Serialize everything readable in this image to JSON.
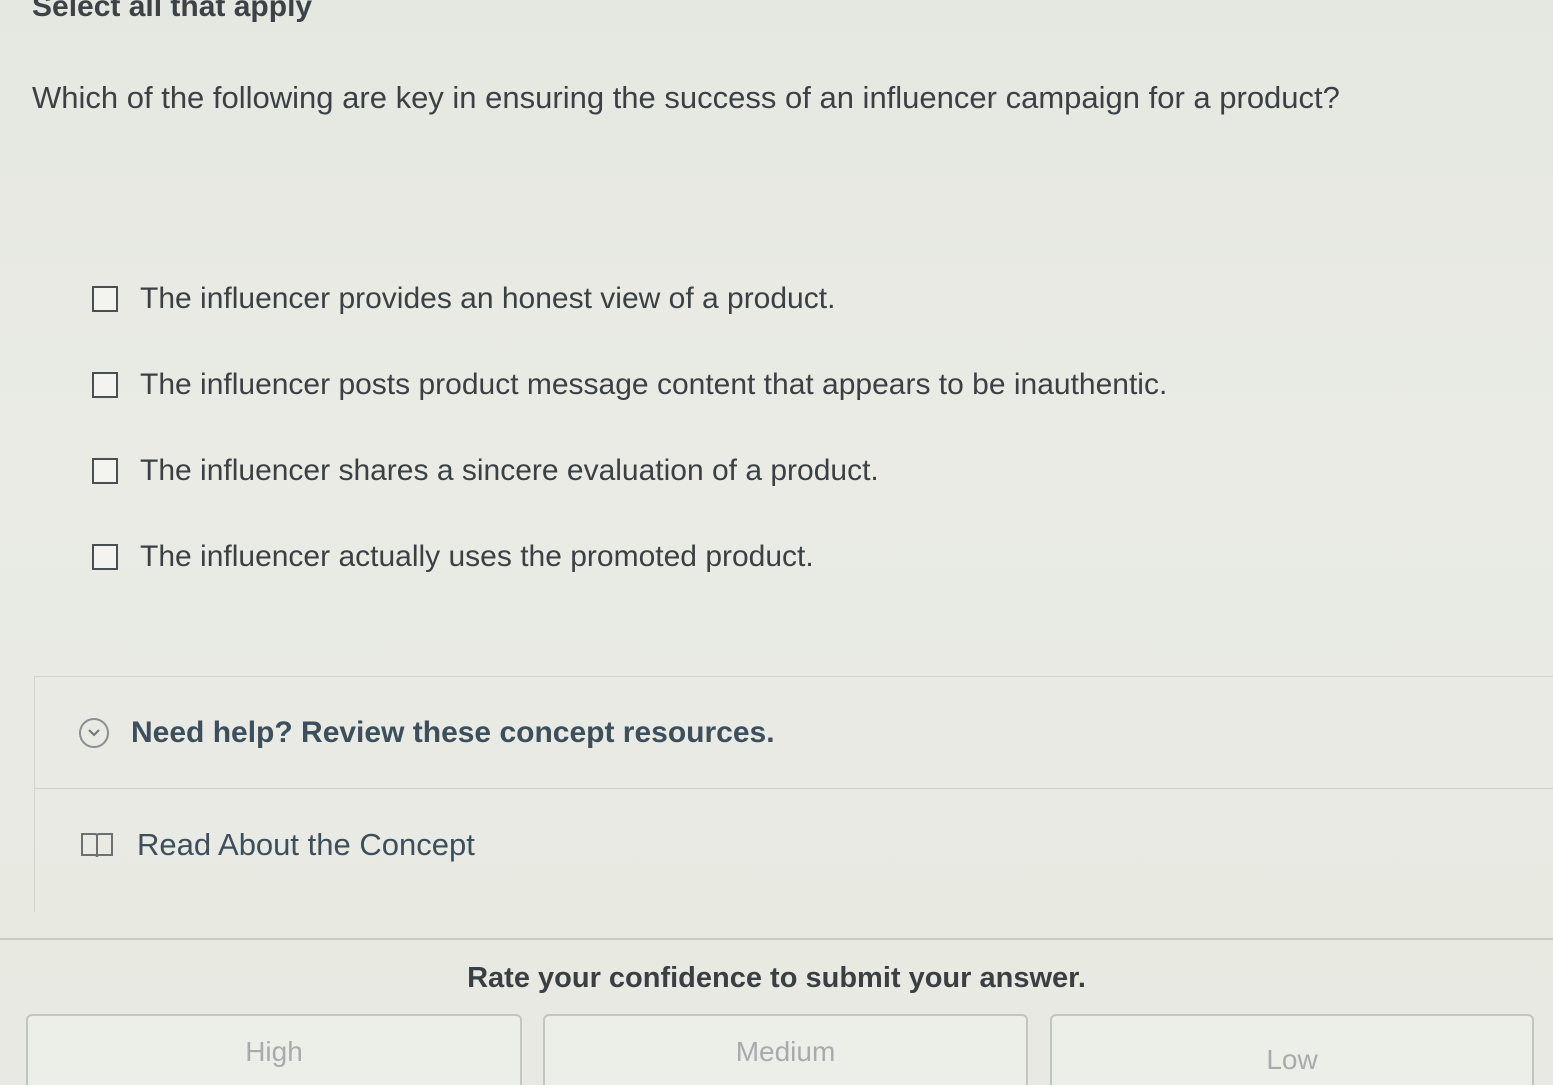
{
  "header": {
    "instruction": "Select all that apply"
  },
  "question": {
    "text": "Which of the following are key in ensuring the success of an influencer campaign for a product?"
  },
  "options": [
    {
      "label": "The influencer provides an honest view of a product.",
      "checked": false
    },
    {
      "label": "The influencer posts product message content that appears to be inauthentic.",
      "checked": false
    },
    {
      "label": "The influencer shares a sincere evaluation of a product.",
      "checked": false
    },
    {
      "label": "The influencer actually uses the promoted product.",
      "checked": false
    }
  ],
  "help": {
    "title": "Need help? Review these concept resources.",
    "icon": "chevron-down-icon",
    "resources": [
      {
        "label": "Read About the Concept",
        "icon": "book-icon"
      }
    ]
  },
  "confidence": {
    "prompt": "Rate your confidence to submit your answer.",
    "buttons": {
      "high": "High",
      "medium": "Medium",
      "low": "Low"
    }
  }
}
